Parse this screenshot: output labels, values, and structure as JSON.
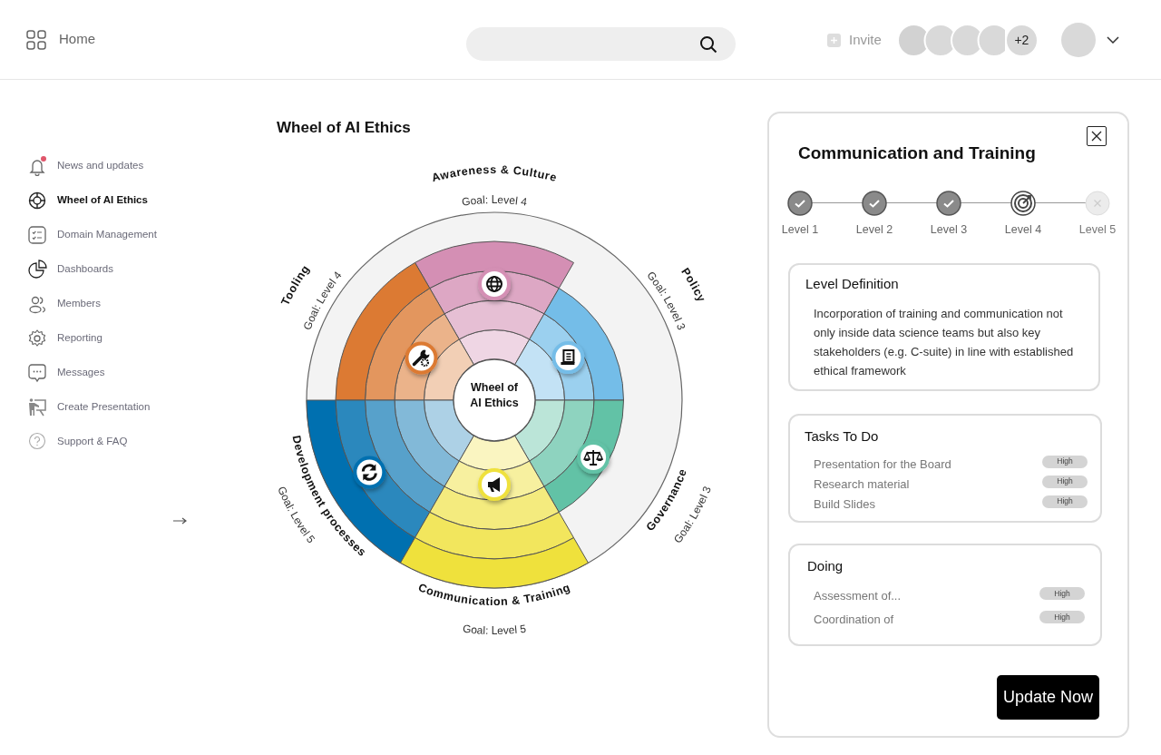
{
  "header": {
    "home": "Home",
    "invite": "Invite",
    "members_extra": "+2"
  },
  "sidebar": {
    "items": [
      {
        "label": "News and updates",
        "selected": false,
        "unread": true
      },
      {
        "label": "Wheel of AI Ethics",
        "selected": true,
        "unread": false
      },
      {
        "label": "Domain Management",
        "selected": false,
        "unread": false
      },
      {
        "label": "Dashboards",
        "selected": false,
        "unread": false
      },
      {
        "label": "Members",
        "selected": false,
        "unread": false
      },
      {
        "label": "Reporting",
        "selected": false,
        "unread": false
      },
      {
        "label": "Messages",
        "selected": false,
        "unread": false
      },
      {
        "label": "Create Presentation",
        "selected": false,
        "unread": false
      },
      {
        "label": "Support & FAQ",
        "selected": false,
        "unread": false
      }
    ]
  },
  "wheel": {
    "title": "Wheel of AI Ethics",
    "center_label": "Wheel of AI Ethics",
    "sectors": [
      {
        "label": "Awareness & Culture",
        "goal": "Goal: Level 4",
        "color": "#d48fb4",
        "rings": [
          {
            "filled": true
          },
          {
            "filled": true
          },
          {
            "filled": true
          },
          {
            "filled": true
          },
          {
            "filled": false
          }
        ]
      },
      {
        "label": "Tooling",
        "goal": "Goal: Level 4",
        "color": "#dc7a33",
        "rings": [
          {
            "filled": true
          },
          {
            "filled": true
          },
          {
            "filled": true
          },
          {
            "filled": true
          },
          {
            "filled": false
          }
        ]
      },
      {
        "label": "Policy",
        "goal": "Goal: Level 3",
        "color": "#74bde8",
        "rings": [
          {
            "filled": true
          },
          {
            "filled": true
          },
          {
            "filled": true
          },
          {
            "filled": false
          },
          {
            "filled": false
          }
        ]
      },
      {
        "label": "Development processes",
        "goal": "Goal: Level 5",
        "color": "#0070b0",
        "rings": [
          {
            "filled": true
          },
          {
            "filled": true
          },
          {
            "filled": true
          },
          {
            "filled": true
          },
          {
            "filled": true
          }
        ]
      },
      {
        "label": "Governance",
        "goal": "Goal: Level 3",
        "color": "#62c2a6",
        "rings": [
          {
            "filled": true
          },
          {
            "filled": true
          },
          {
            "filled": true
          },
          {
            "filled": false
          },
          {
            "filled": false
          }
        ]
      },
      {
        "label": "Communication & Training",
        "goal": "Goal: Level 5",
        "color": "#efe13c",
        "rings": [
          {
            "filled": true
          },
          {
            "filled": true
          },
          {
            "filled": true
          },
          {
            "filled": true
          },
          {
            "filled": true
          }
        ]
      }
    ]
  },
  "panel": {
    "title": "Communication and Training",
    "levels": [
      {
        "label": "Level 1",
        "kind": "done"
      },
      {
        "label": "Level 2",
        "kind": "done"
      },
      {
        "label": "Level 3",
        "kind": "done"
      },
      {
        "label": "Level 4",
        "kind": "current"
      },
      {
        "label": "Level 5",
        "kind": "locked"
      }
    ],
    "definition": {
      "heading": "Level Definition",
      "text": "Incorporation of training and communication not only inside data science teams but also key stakeholders (e.g. C-suite) in line with established ethical framework"
    },
    "todo": {
      "heading": "Tasks To Do",
      "tasks": [
        {
          "label": "Presentation for the Board",
          "priority": "High"
        },
        {
          "label": "Research material",
          "priority": "High"
        },
        {
          "label": "Build Slides",
          "priority": "High"
        }
      ]
    },
    "doing": {
      "heading": "Doing",
      "tasks": [
        {
          "label": "Assessment of...",
          "priority": "High"
        },
        {
          "label": "Coordination of",
          "priority": "High"
        }
      ]
    },
    "button": "Update Now"
  }
}
